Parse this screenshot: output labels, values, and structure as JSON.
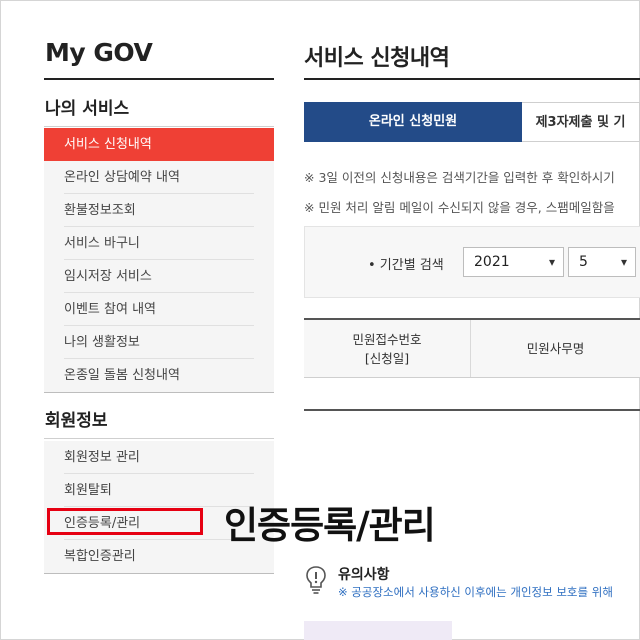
{
  "sidebar": {
    "title": "My GOV",
    "section1": {
      "title": "나의 서비스",
      "items": [
        {
          "label": "서비스 신청내역",
          "active": true
        },
        {
          "label": "온라인 상담예약 내역"
        },
        {
          "label": "환불정보조회"
        },
        {
          "label": "서비스 바구니"
        },
        {
          "label": "임시저장 서비스"
        },
        {
          "label": "이벤트 참여 내역"
        },
        {
          "label": "나의 생활정보"
        },
        {
          "label": "온종일 돌봄 신청내역"
        }
      ]
    },
    "section2": {
      "title": "회원정보",
      "items": [
        {
          "label": "회원정보 관리"
        },
        {
          "label": "회원탈퇴"
        },
        {
          "label": "인증등록/관리"
        },
        {
          "label": "복합인증관리"
        }
      ]
    }
  },
  "annotation": {
    "caption": "인증등록/관리",
    "highlight_color": "#e60012"
  },
  "main": {
    "title": "서비스 신청내역",
    "tabs": [
      {
        "label": "온라인 신청민원",
        "active": true
      },
      {
        "label": "제3자제출 및 기"
      }
    ],
    "notices": [
      "※ 3일 이전의 신청내용은 검색기간을 입력한 후 확인하시기",
      "※ 민원 처리 알림 메일이 수신되지 않을 경우, 스팸메일함을"
    ],
    "search": {
      "label": "• 기간별 검색",
      "year": "2021",
      "month": "5"
    },
    "table": {
      "col1_line1": "민원접수번호",
      "col1_line2": "[신청일]",
      "col2": "민원사무명"
    },
    "caution": {
      "title": "유의사항",
      "text": "※ 공공장소에서 사용하신 이후에는 개인정보 보호를 위해"
    }
  },
  "colors": {
    "active_menu": "#ef4035",
    "active_tab": "#234b88",
    "caution_text": "#2f6fc1"
  }
}
